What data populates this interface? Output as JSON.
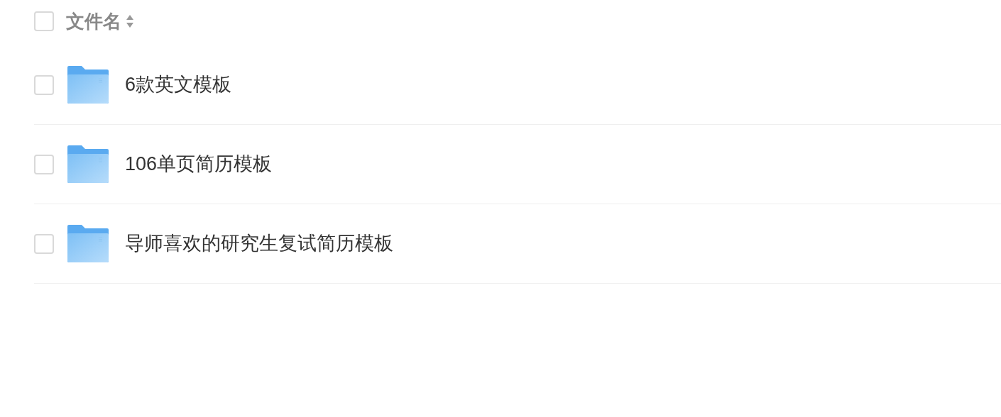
{
  "header": {
    "label": "文件名",
    "checked": false
  },
  "rows": [
    {
      "name": "6款英文模板",
      "checked": false
    },
    {
      "name": "106单页简历模板",
      "checked": false
    },
    {
      "name": "导师喜欢的研究生复试简历模板",
      "checked": false
    }
  ]
}
